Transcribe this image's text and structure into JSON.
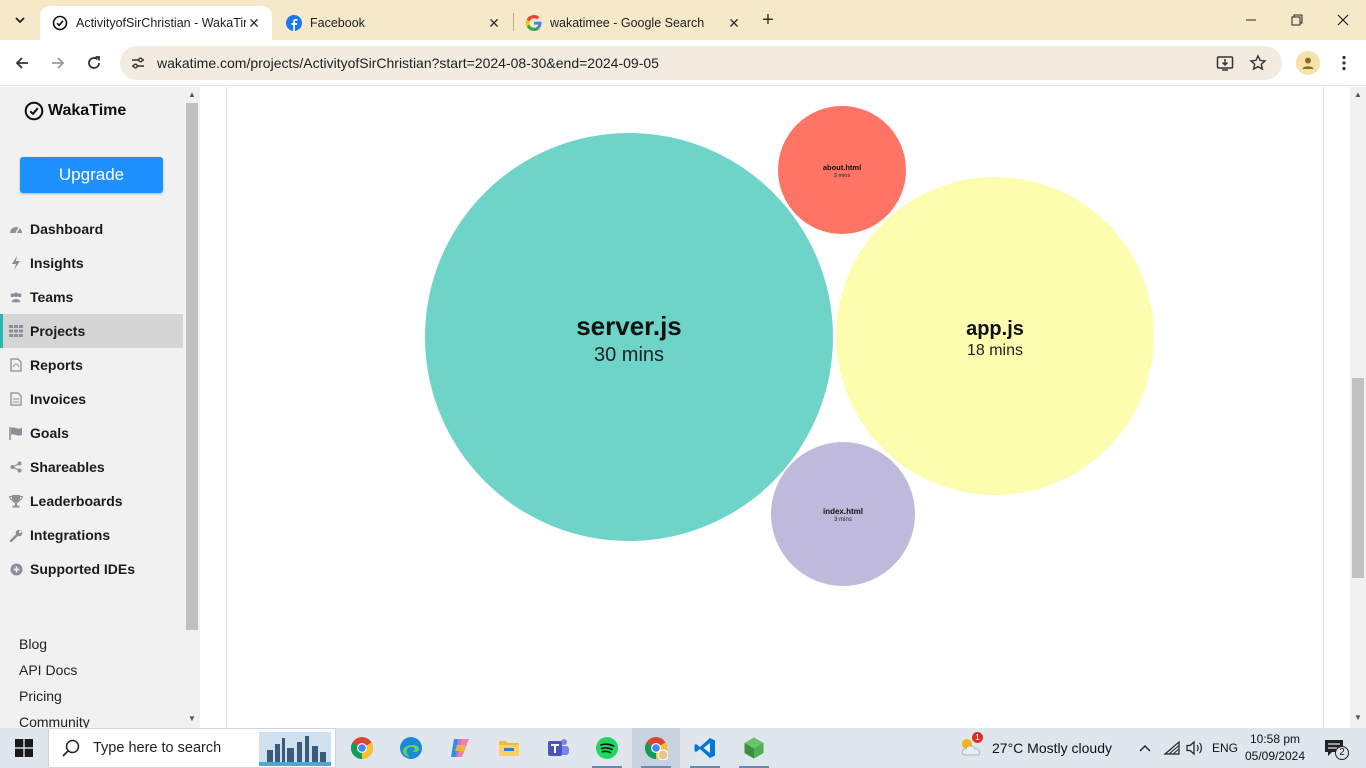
{
  "browser": {
    "tabs": [
      {
        "title": "ActivityofSirChristian - WakaTime",
        "icon": "wakatime-icon"
      },
      {
        "title": "Facebook",
        "icon": "facebook-icon"
      },
      {
        "title": "wakatimee - Google Search",
        "icon": "google-icon"
      }
    ],
    "url": "wakatime.com/projects/ActivityofSirChristian?start=2024-08-30&end=2024-09-05"
  },
  "sidebar": {
    "brand": "WakaTime",
    "upgrade_label": "Upgrade",
    "items": [
      {
        "label": "Dashboard",
        "icon": "dashboard-icon"
      },
      {
        "label": "Insights",
        "icon": "bolt-icon"
      },
      {
        "label": "Teams",
        "icon": "users-icon"
      },
      {
        "label": "Projects",
        "icon": "grid-icon",
        "active": true
      },
      {
        "label": "Reports",
        "icon": "pdf-icon"
      },
      {
        "label": "Invoices",
        "icon": "file-icon"
      },
      {
        "label": "Goals",
        "icon": "flag-icon"
      },
      {
        "label": "Shareables",
        "icon": "share-icon"
      },
      {
        "label": "Leaderboards",
        "icon": "trophy-icon"
      },
      {
        "label": "Integrations",
        "icon": "wrench-icon"
      },
      {
        "label": "Supported IDEs",
        "icon": "plus-circle-icon"
      }
    ],
    "footer_links": [
      "Blog",
      "API Docs",
      "Pricing",
      "Community"
    ]
  },
  "files_chart": {
    "type": "bubble",
    "bubbles": [
      {
        "name": "server.js",
        "duration": "30 mins",
        "minutes": 30,
        "color": "#6fd4c8"
      },
      {
        "name": "app.js",
        "duration": "18 mins",
        "minutes": 18,
        "color": "#fdfdb0"
      },
      {
        "name": "about.html",
        "duration": "3 mins",
        "minutes": 3,
        "color": "#ff7464"
      },
      {
        "name": "index.html",
        "duration": "3 mins",
        "minutes": 3,
        "color": "#bfbadb"
      }
    ]
  },
  "taskbar": {
    "search_placeholder": "Type here to search",
    "weather": "27°C  Mostly cloudy",
    "weather_badge": "1",
    "language": "ENG",
    "time": "10:58 pm",
    "date": "05/09/2024",
    "notifications": "2",
    "apps": [
      "chrome-icon",
      "edge-icon",
      "copilot-icon",
      "file-explorer-icon",
      "teams-icon",
      "spotify-icon",
      "chrome-profile-icon",
      "vscode-icon",
      "nodejs-icon"
    ]
  }
}
